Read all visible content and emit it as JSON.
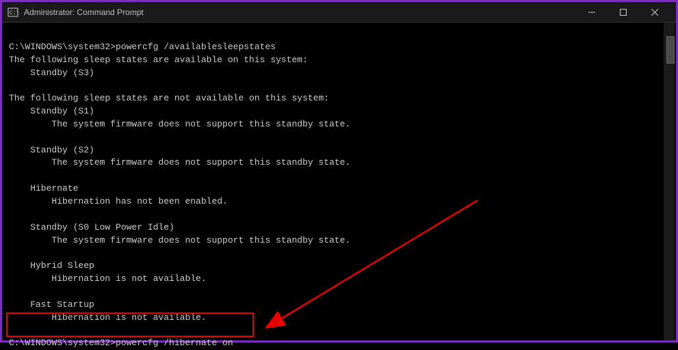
{
  "window": {
    "title": "Administrator: Command Prompt"
  },
  "terminal": {
    "prompt1": "C:\\WINDOWS\\system32>",
    "command1": "powercfg /availablesleepstates",
    "output": {
      "available_header": "The following sleep states are available on this system:",
      "available1": "    Standby (S3)",
      "not_available_header": "The following sleep states are not available on this system:",
      "na1_name": "    Standby (S1)",
      "na1_reason": "        The system firmware does not support this standby state.",
      "na2_name": "    Standby (S2)",
      "na2_reason": "        The system firmware does not support this standby state.",
      "na3_name": "    Hibernate",
      "na3_reason": "        Hibernation has not been enabled.",
      "na4_name": "    Standby (S0 Low Power Idle)",
      "na4_reason": "        The system firmware does not support this standby state.",
      "na5_name": "    Hybrid Sleep",
      "na5_reason": "        Hibernation is not available.",
      "na6_name": "    Fast Startup",
      "na6_reason": "        Hibernation is not available."
    },
    "prompt2": "C:\\WINDOWS\\system32>",
    "command2": "powercfg /hibernate on"
  },
  "annotation": {
    "highlight_color": "#e60000",
    "border_color": "#7b2fbf"
  }
}
